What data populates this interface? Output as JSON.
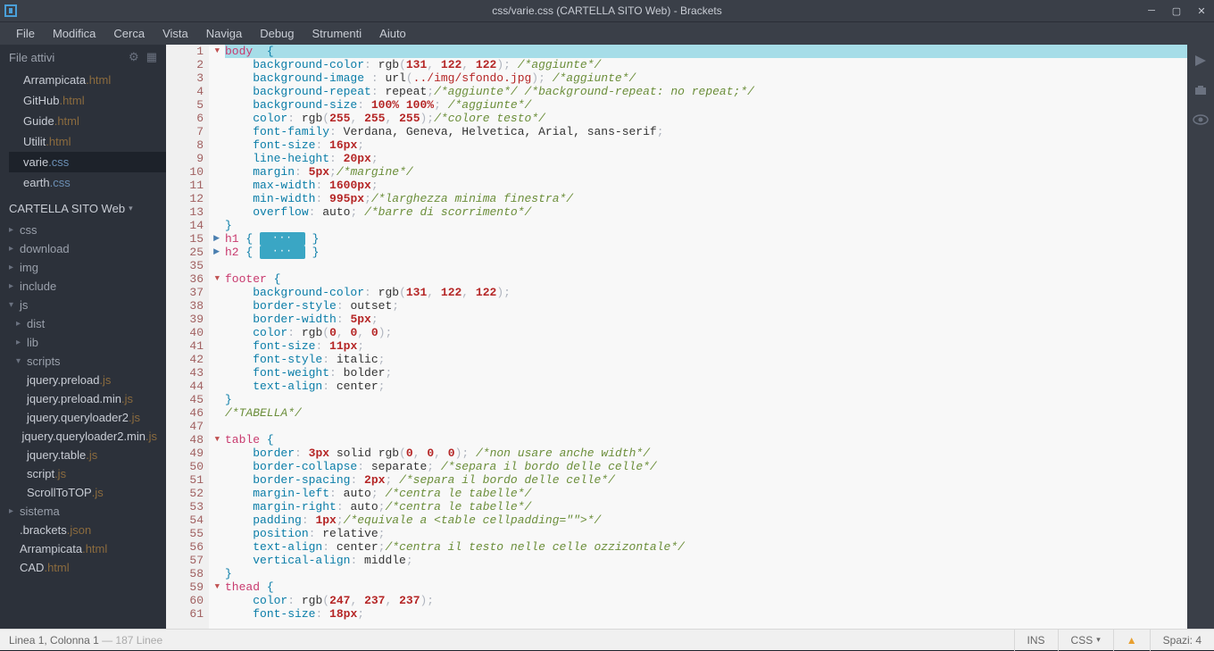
{
  "titlebar": {
    "title": "css/varie.css (CARTELLA SITO Web) - Brackets"
  },
  "menubar": [
    "File",
    "Modifica",
    "Cerca",
    "Vista",
    "Naviga",
    "Debug",
    "Strumenti",
    "Aiuto"
  ],
  "working_files_hdr": "File attivi",
  "working_files": [
    {
      "base": "Arrampicata",
      "ext": ".html",
      "extclass": "fn-ext"
    },
    {
      "base": "GitHub",
      "ext": ".html",
      "extclass": "fn-ext"
    },
    {
      "base": "Guide",
      "ext": ".html",
      "extclass": "fn-ext"
    },
    {
      "base": "Utilit",
      "ext": ".html",
      "extclass": "fn-ext"
    },
    {
      "base": "varie",
      "ext": ".css",
      "extclass": "fn-ext-css",
      "active": true
    },
    {
      "base": "earth",
      "ext": ".css",
      "extclass": "fn-ext-css"
    }
  ],
  "project_name": "CARTELLA SITO Web",
  "tree": [
    {
      "label": "css",
      "depth": 0,
      "type": "folder",
      "open": false
    },
    {
      "label": "download",
      "depth": 0,
      "type": "folder",
      "open": false
    },
    {
      "label": "img",
      "depth": 0,
      "type": "folder",
      "open": false
    },
    {
      "label": "include",
      "depth": 0,
      "type": "folder",
      "open": false
    },
    {
      "label": "js",
      "depth": 0,
      "type": "folder",
      "open": true
    },
    {
      "label": "dist",
      "depth": 1,
      "type": "folder",
      "open": false
    },
    {
      "label": "lib",
      "depth": 1,
      "type": "folder",
      "open": false
    },
    {
      "label": "scripts",
      "depth": 1,
      "type": "folder",
      "open": true
    },
    {
      "base": "jquery.preload",
      "ext": ".js",
      "depth": 1,
      "type": "file"
    },
    {
      "base": "jquery.preload.min",
      "ext": ".js",
      "depth": 1,
      "type": "file"
    },
    {
      "base": "jquery.queryloader2",
      "ext": ".js",
      "depth": 1,
      "type": "file"
    },
    {
      "base": "jquery.queryloader2.min",
      "ext": ".js",
      "depth": 1,
      "type": "file"
    },
    {
      "base": "jquery.table",
      "ext": ".js",
      "depth": 1,
      "type": "file"
    },
    {
      "base": "script",
      "ext": ".js",
      "depth": 1,
      "type": "file"
    },
    {
      "base": "ScrollToTOP",
      "ext": ".js",
      "depth": 1,
      "type": "file"
    },
    {
      "label": "sistema",
      "depth": 0,
      "type": "folder",
      "open": false
    },
    {
      "base": ".brackets",
      "ext": ".json",
      "depth": 0,
      "type": "file"
    },
    {
      "base": "Arrampicata",
      "ext": ".html",
      "depth": 0,
      "type": "file"
    },
    {
      "base": "CAD",
      "ext": ".html",
      "depth": 0,
      "type": "file"
    }
  ],
  "editor_lines": [
    {
      "n": 1,
      "fold": "▼",
      "hl": true,
      "html": "<span class='selector'>body</span>  <span class='brace'>{</span>"
    },
    {
      "n": 2,
      "html": "    <span class='prop'>background-color</span>: <span class='fn'>rgb</span>(<span class='num'>131</span>, <span class='num'>122</span>, <span class='num'>122</span>); <span class='comment'>/*aggiunte*/</span>"
    },
    {
      "n": 3,
      "html": "    <span class='prop'>background-image</span> : <span class='fn'>url</span>(<span class='str'>../img/sfondo.jpg</span>); <span class='comment'>/*aggiunte*/</span>"
    },
    {
      "n": 4,
      "html": "    <span class='prop'>background-repeat</span>: <span class='val'>repeat</span>;<span class='comment'>/*aggiunte*/ /*background-repeat: no repeat;*/</span>"
    },
    {
      "n": 5,
      "html": "    <span class='prop'>background-size</span>: <span class='num'>100% 100%</span>; <span class='comment'>/*aggiunte*/</span>"
    },
    {
      "n": 6,
      "html": "    <span class='prop'>color</span>: <span class='fn'>rgb</span>(<span class='num'>255</span>, <span class='num'>255</span>, <span class='num'>255</span>);<span class='comment'>/*colore testo*/</span>"
    },
    {
      "n": 7,
      "html": "    <span class='prop'>font-family</span>: <span class='val'>Verdana, Geneva, Helvetica, Arial, sans-serif</span>;"
    },
    {
      "n": 8,
      "html": "    <span class='prop'>font-size</span>: <span class='num'>16px</span>;"
    },
    {
      "n": 9,
      "html": "    <span class='prop'>line-height</span>: <span class='num'>20px</span>;"
    },
    {
      "n": 10,
      "html": "    <span class='prop'>margin</span>: <span class='num'>5px</span>;<span class='comment'>/*margine*/</span>"
    },
    {
      "n": 11,
      "html": "    <span class='prop'>max-width</span>: <span class='num'>1600px</span>;"
    },
    {
      "n": 12,
      "html": "    <span class='prop'>min-width</span>: <span class='num'>995px</span>;<span class='comment'>/*larghezza minima finestra*/</span>"
    },
    {
      "n": 13,
      "html": "    <span class='prop'>overflow</span>: <span class='val'>auto</span>; <span class='comment'>/*barre di scorrimento*/</span>"
    },
    {
      "n": 14,
      "html": "<span class='brace'>}</span>"
    },
    {
      "n": 15,
      "fold": "▶",
      "foldcls": "closed",
      "html": "<span class='selector'>h1</span> <span class='brace'>{</span> <span class='folded'>···</span> <span class='brace'>}</span>"
    },
    {
      "n": 25,
      "fold": "▶",
      "foldcls": "closed",
      "html": "<span class='selector'>h2</span> <span class='brace'>{</span> <span class='folded'>···</span> <span class='brace'>}</span>"
    },
    {
      "n": 35,
      "html": ""
    },
    {
      "n": 36,
      "fold": "▼",
      "html": "<span class='selector'>footer</span> <span class='brace'>{</span>"
    },
    {
      "n": 37,
      "html": "    <span class='prop'>background-color</span>: <span class='fn'>rgb</span>(<span class='num'>131</span>, <span class='num'>122</span>, <span class='num'>122</span>);"
    },
    {
      "n": 38,
      "html": "    <span class='prop'>border-style</span>: <span class='val'>outset</span>;"
    },
    {
      "n": 39,
      "html": "    <span class='prop'>border-width</span>: <span class='num'>5px</span>;"
    },
    {
      "n": 40,
      "html": "    <span class='prop'>color</span>: <span class='fn'>rgb</span>(<span class='num'>0</span>, <span class='num'>0</span>, <span class='num'>0</span>);"
    },
    {
      "n": 41,
      "html": "    <span class='prop'>font-size</span>: <span class='num'>11px</span>;"
    },
    {
      "n": 42,
      "html": "    <span class='prop'>font-style</span>: <span class='val'>italic</span>;"
    },
    {
      "n": 43,
      "html": "    <span class='prop'>font-weight</span>: <span class='val'>bolder</span>;"
    },
    {
      "n": 44,
      "html": "    <span class='prop'>text-align</span>: <span class='val'>center</span>;"
    },
    {
      "n": 45,
      "html": "<span class='brace'>}</span>"
    },
    {
      "n": 46,
      "html": "<span class='comment'>/*TABELLA*/</span>"
    },
    {
      "n": 47,
      "html": ""
    },
    {
      "n": 48,
      "fold": "▼",
      "html": "<span class='selector'>table</span> <span class='brace'>{</span>"
    },
    {
      "n": 49,
      "html": "    <span class='prop'>border</span>: <span class='num'>3px</span> <span class='val'>solid</span> <span class='fn'>rgb</span>(<span class='num'>0</span>, <span class='num'>0</span>, <span class='num'>0</span>); <span class='comment'>/*non usare anche width*/</span>"
    },
    {
      "n": 50,
      "html": "    <span class='prop'>border-collapse</span>: <span class='val'>separate</span>; <span class='comment'>/*separa il bordo delle celle*/</span>"
    },
    {
      "n": 51,
      "html": "    <span class='prop'>border-spacing</span>: <span class='num'>2px</span>; <span class='comment'>/*separa il bordo delle celle*/</span>"
    },
    {
      "n": 52,
      "html": "    <span class='prop'>margin-left</span>: <span class='val'>auto</span>; <span class='comment'>/*centra le tabelle*/</span>"
    },
    {
      "n": 53,
      "html": "    <span class='prop'>margin-right</span>: <span class='val'>auto</span>;<span class='comment'>/*centra le tabelle*/</span>"
    },
    {
      "n": 54,
      "html": "    <span class='prop'>padding</span>: <span class='num'>1px</span>;<span class='comment'>/*equivale a &lt;table cellpadding=&quot;&quot;&gt;*/</span>"
    },
    {
      "n": 55,
      "html": "    <span class='prop'>position</span>: <span class='val'>relative</span>;"
    },
    {
      "n": 56,
      "html": "    <span class='prop'>text-align</span>: <span class='val'>center</span>;<span class='comment'>/*centra il testo nelle celle ozzizontale*/</span>"
    },
    {
      "n": 57,
      "html": "    <span class='prop'>vertical-align</span>: <span class='val'>middle</span>;"
    },
    {
      "n": 58,
      "html": "<span class='brace'>}</span>"
    },
    {
      "n": 59,
      "fold": "▼",
      "html": "<span class='selector'>thead</span> <span class='brace'>{</span>"
    },
    {
      "n": 60,
      "html": "    <span class='prop'>color</span>: <span class='fn'>rgb</span>(<span class='num'>247</span>, <span class='num'>237</span>, <span class='num'>237</span>);"
    },
    {
      "n": 61,
      "html": "    <span class='prop'>font-size</span>: <span class='num'>18px</span>;"
    }
  ],
  "statusbar": {
    "cursor": "Linea 1, Colonna 1",
    "lines": "— 187 Linee",
    "ins": "INS",
    "lang": "CSS",
    "spaces": "Spazi: 4"
  }
}
